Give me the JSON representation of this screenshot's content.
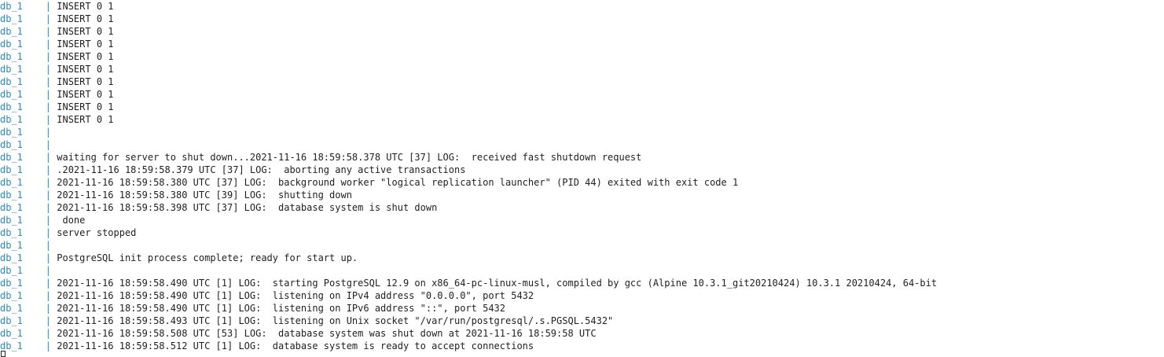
{
  "terminal": {
    "service_prefix": "db_1    | ",
    "lines": [
      "INSERT 0 1",
      "INSERT 0 1",
      "INSERT 0 1",
      "INSERT 0 1",
      "INSERT 0 1",
      "INSERT 0 1",
      "INSERT 0 1",
      "INSERT 0 1",
      "INSERT 0 1",
      "INSERT 0 1",
      "",
      "",
      "waiting for server to shut down...2021-11-16 18:59:58.378 UTC [37] LOG:  received fast shutdown request",
      ".2021-11-16 18:59:58.379 UTC [37] LOG:  aborting any active transactions",
      "2021-11-16 18:59:58.380 UTC [37] LOG:  background worker \"logical replication launcher\" (PID 44) exited with exit code 1",
      "2021-11-16 18:59:58.380 UTC [39] LOG:  shutting down",
      "2021-11-16 18:59:58.398 UTC [37] LOG:  database system is shut down",
      " done",
      "server stopped",
      "",
      "PostgreSQL init process complete; ready for start up.",
      "",
      "2021-11-16 18:59:58.490 UTC [1] LOG:  starting PostgreSQL 12.9 on x86_64-pc-linux-musl, compiled by gcc (Alpine 10.3.1_git20210424) 10.3.1 20210424, 64-bit",
      "2021-11-16 18:59:58.490 UTC [1] LOG:  listening on IPv4 address \"0.0.0.0\", port 5432",
      "2021-11-16 18:59:58.490 UTC [1] LOG:  listening on IPv6 address \"::\", port 5432",
      "2021-11-16 18:59:58.493 UTC [1] LOG:  listening on Unix socket \"/var/run/postgresql/.s.PGSQL.5432\"",
      "2021-11-16 18:59:58.508 UTC [53] LOG:  database system was shut down at 2021-11-16 18:59:58 UTC",
      "2021-11-16 18:59:58.512 UTC [1] LOG:  database system is ready to accept connections"
    ]
  },
  "colors": {
    "prefix": "#2a8ac4",
    "text": "#1f1f1f",
    "background": "#ffffff"
  }
}
